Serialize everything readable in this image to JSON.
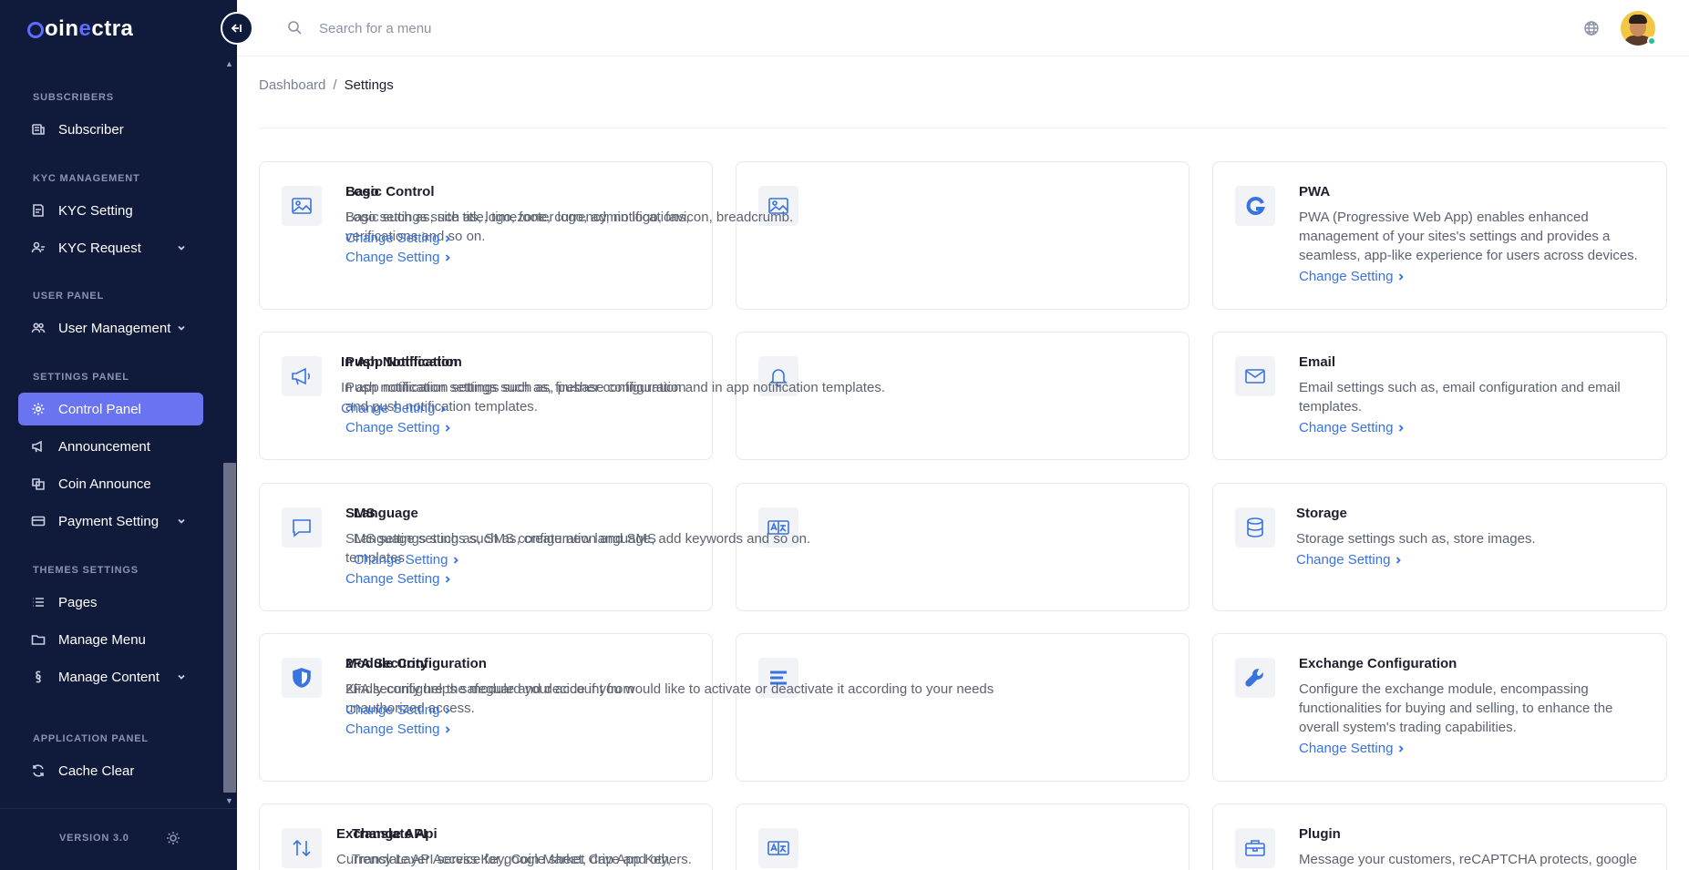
{
  "brand": {
    "prefix": "oin",
    "accent": "e",
    "suffix": "ctra"
  },
  "sidebar": {
    "sections": [
      {
        "label": "SUBSCRIBERS",
        "top": 0
      },
      {
        "label": "KYC MANAGEMENT"
      },
      {
        "label": "USER PANEL"
      },
      {
        "label": "SETTINGS PANEL"
      },
      {
        "label": "THEMES SETTINGS"
      },
      {
        "label": "APPLICATION PANEL"
      }
    ],
    "items": {
      "subscriber": "Subscriber",
      "kyc_setting": "KYC Setting",
      "kyc_request": "KYC Request",
      "user_management": "User Management",
      "control_panel": "Control Panel",
      "announcement": "Announcement",
      "coin_announce": "Coin Announce",
      "payment_setting": "Payment Setting",
      "pages": "Pages",
      "manage_menu": "Manage Menu",
      "manage_content": "Manage Content",
      "cache_clear": "Cache Clear"
    },
    "version": "VERSION 3.0"
  },
  "header": {
    "search_placeholder": "Search for a menu"
  },
  "breadcrumb": {
    "root": "Dashboard",
    "separator": "/",
    "current": "Settings"
  },
  "colors": {
    "sidebar_bg": "#101a3a",
    "active_item": "#6b74f0",
    "link": "#3873e0"
  },
  "cards": [
    {
      "title": "Basic Control",
      "desc": "Basic such as, site title, timezone, currency, notifications, verifications and so on.",
      "link": "Change Setting",
      "icon": "image-icon"
    },
    {
      "title": "Logo",
      "desc": "Logo settings such as, logo, footer logo, admin logo, favicon, breadcrumb.",
      "link": "Change Setting",
      "icon": "image-icon"
    },
    {
      "title": "PWA",
      "desc": "PWA (Progressive Web App) enables enhanced management of your sites's settings and provides a seamless, app-like experience for users across devices.",
      "link": "Change Setting",
      "icon": "pwa-icon"
    },
    {
      "title": "Push Notification",
      "desc": "Push notification settings such as, firebase configuration and push notification templates.",
      "link": "Change Setting",
      "icon": "megaphone-icon"
    },
    {
      "title": "In App Notification",
      "desc": "In app notification settings such as, pusher configuration and in app notification templates.",
      "link": "Change Setting",
      "icon": "bell-icon"
    },
    {
      "title": "Email",
      "desc": "Email settings such as, email configuration and email templates.",
      "link": "Change Setting",
      "icon": "envelope-icon"
    },
    {
      "title": "SMS",
      "desc": "SMS settings such as, SMS configuration and SMS templates.",
      "link": "Change Setting",
      "icon": "chat-icon"
    },
    {
      "title": "Language",
      "desc": "Language settings such as, create new language, add keywords and so on.",
      "link": "Change Setting",
      "icon": "translate-icon"
    },
    {
      "title": "Storage",
      "desc": "Storage settings such as, store images.",
      "link": "Change Setting",
      "icon": "database-icon"
    },
    {
      "title": "2FA Security",
      "desc": "2FA security helps safeguard your account from unauthorized access.",
      "link": "Change Setting",
      "icon": "shield-icon"
    },
    {
      "title": "Module Configuration",
      "desc": "Kindly configure the module and decide if you would like to activate or deactivate it according to your needs",
      "link": "Change Setting",
      "icon": "menu-lines-icon"
    },
    {
      "title": "Exchange Configuration",
      "desc": "Configure the exchange module, encompassing functionalities for buying and selling, to enhance the overall system's trading capabilities.",
      "link": "Change Setting",
      "icon": "wrench-icon"
    },
    {
      "title": "Exchange API",
      "desc": "Currency Layer Access Key, Coin Market Cap App Key,",
      "link": "",
      "icon": "arrows-updown-icon"
    },
    {
      "title": "Translate Api",
      "desc": "Translate API service for google sheet, drive and others.",
      "link": "",
      "icon": "translate-icon"
    },
    {
      "title": "Plugin",
      "desc": "Message your customers, reCAPTCHA protects, google",
      "link": "",
      "icon": "toolbox-icon"
    }
  ]
}
